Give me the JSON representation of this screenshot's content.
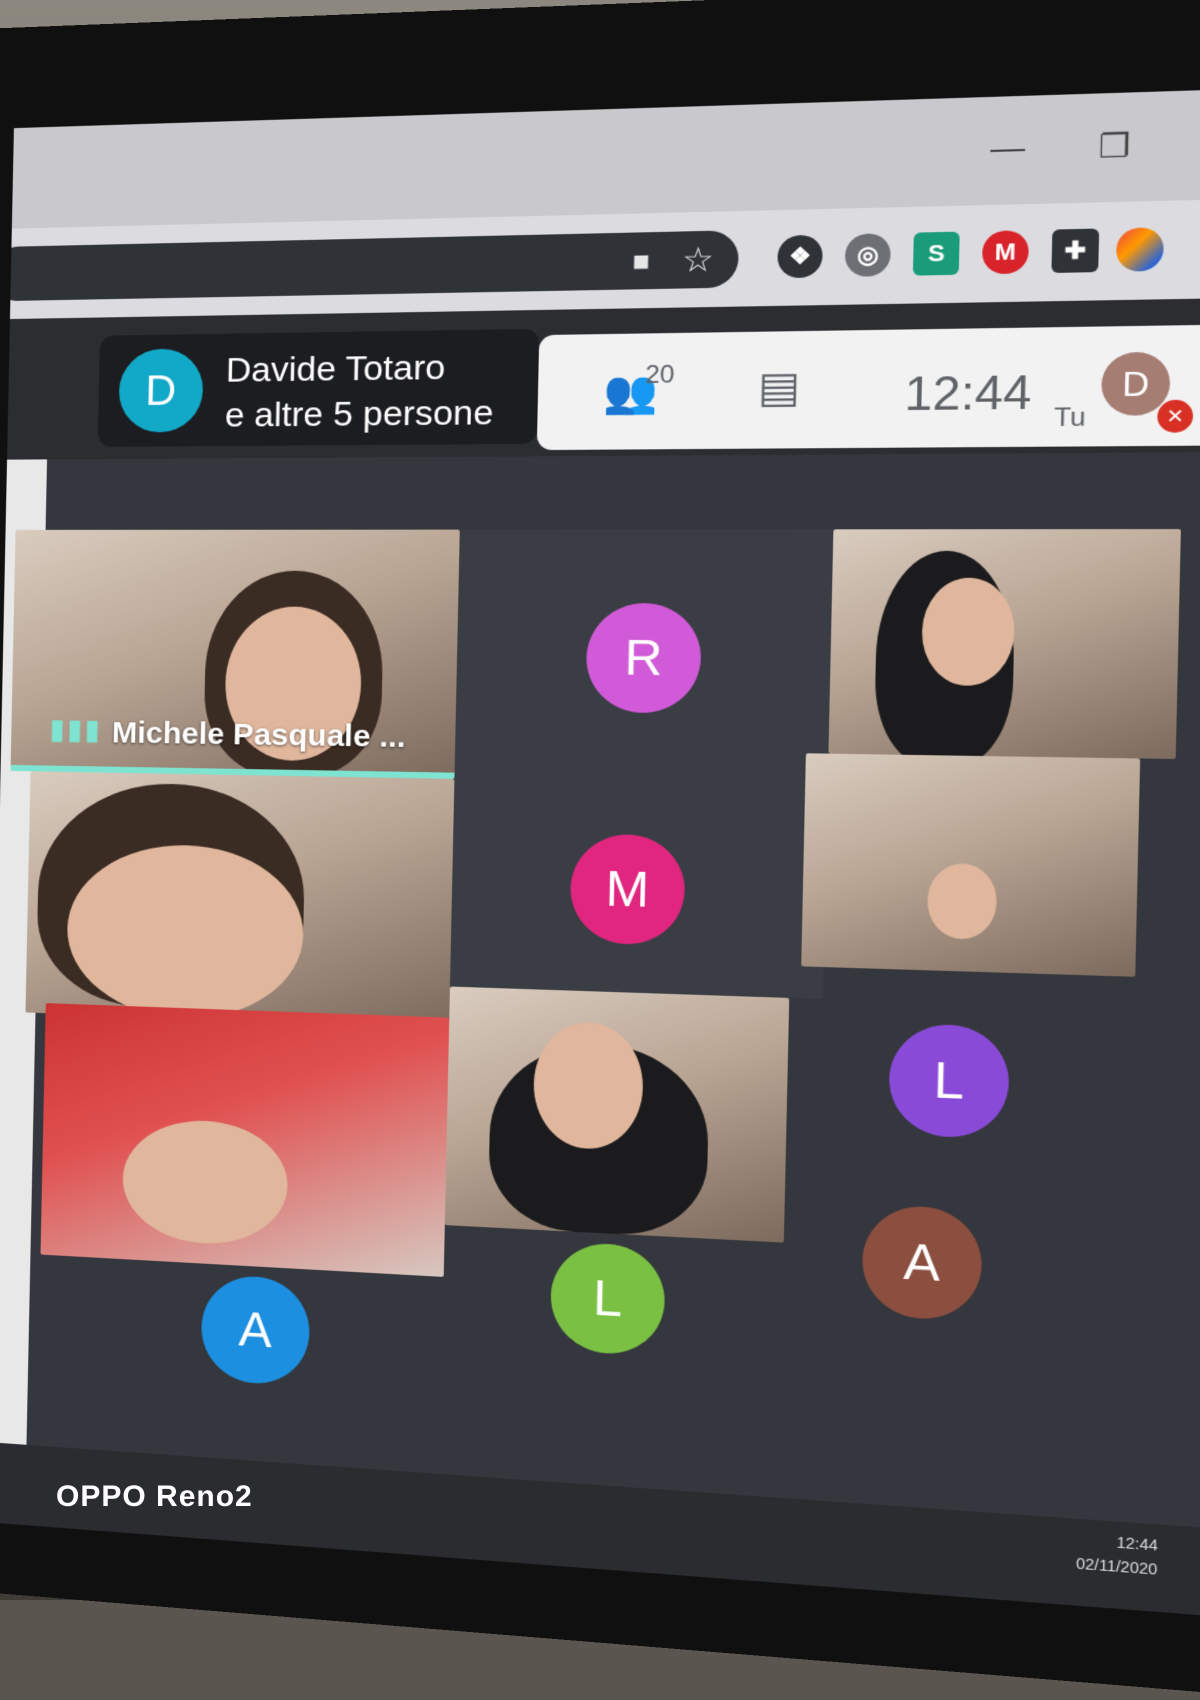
{
  "window": {
    "minimize": "—",
    "maximize": "❐",
    "close": "✕"
  },
  "omnibox": {
    "camera_icon": "■",
    "star_icon": "☆"
  },
  "extensions": {
    "dropbox": "❖",
    "headset": "◎",
    "s": "S",
    "mega": "M",
    "puzzle": "✚",
    "profile": "",
    "menu": "⋮"
  },
  "presenter": {
    "avatar_letter": "D",
    "name": "Davide Totaro",
    "subtitle": "e altre 5 persone"
  },
  "meet_bar": {
    "participants_count": "20",
    "clock": "12:44",
    "self_letter": "D",
    "self_label": "Tu"
  },
  "tiles": {
    "featured_name": "Michele Pasquale ...",
    "avatars": [
      "R",
      "M",
      "L",
      "A",
      "L",
      "A"
    ]
  },
  "taskbar": {
    "time": "12:44",
    "date": "02/11/2020"
  },
  "watermark": "OPPO Reno2"
}
